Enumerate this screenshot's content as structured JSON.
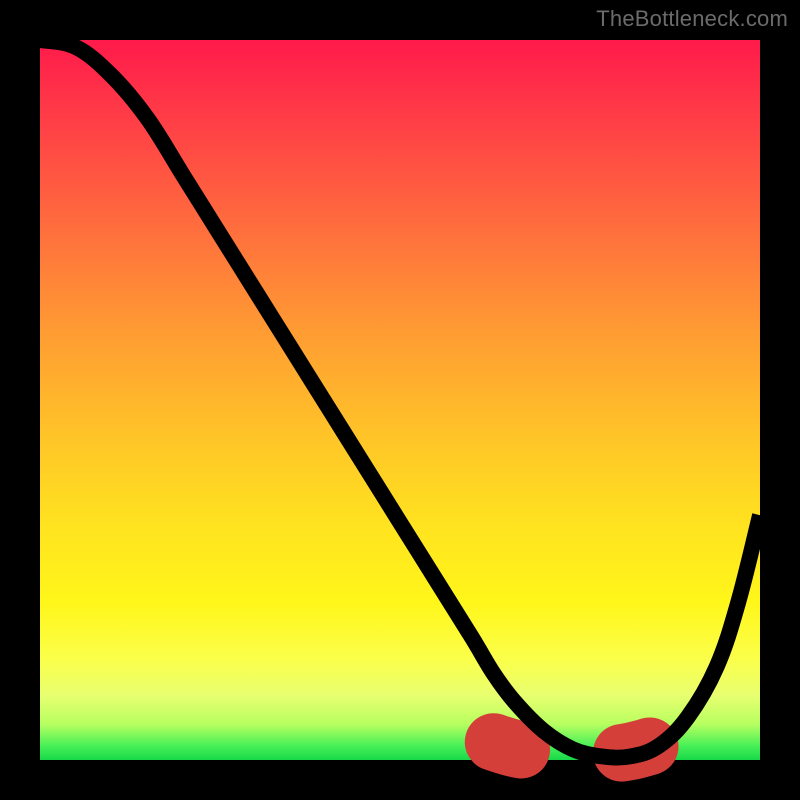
{
  "watermark": "TheBottleneck.com",
  "chart_data": {
    "type": "line",
    "title": "",
    "xlabel": "",
    "ylabel": "",
    "xlim": [
      0,
      100
    ],
    "ylim": [
      0,
      100
    ],
    "grid": false,
    "legend": false,
    "series": [
      {
        "name": "primary-curve",
        "x": [
          0,
          5,
          10,
          15,
          20,
          25,
          30,
          35,
          40,
          45,
          50,
          55,
          60,
          63,
          66,
          70,
          74,
          78,
          82,
          86,
          90,
          94,
          97,
          100
        ],
        "y": [
          100,
          99,
          95,
          89,
          81,
          73,
          65,
          57,
          49,
          41,
          33,
          25,
          17,
          12,
          8,
          4,
          1.5,
          0.5,
          0.5,
          2,
          6,
          13,
          22,
          34
        ]
      },
      {
        "name": "highlight-dash",
        "x": [
          63,
          66,
          70,
          74,
          78,
          82,
          85
        ],
        "y": [
          2.5,
          1.6,
          1.0,
          0.7,
          0.7,
          1.2,
          2.0
        ]
      }
    ],
    "colors": {
      "curve": "#000000",
      "dash": "#d43f3a",
      "gradient_top": "#ff1a4b",
      "gradient_bottom": "#18d94a"
    }
  }
}
